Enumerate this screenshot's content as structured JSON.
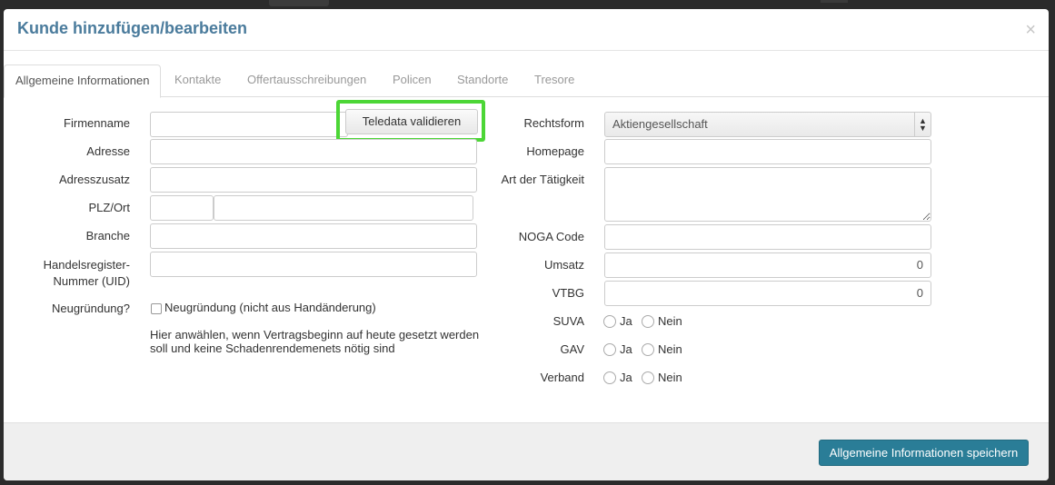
{
  "modal": {
    "title": "Kunde hinzufügen/bearbeiten",
    "close": "×"
  },
  "tabs": [
    {
      "label": "Allgemeine Informationen"
    },
    {
      "label": "Kontakte"
    },
    {
      "label": "Offertausschreibungen"
    },
    {
      "label": "Policen"
    },
    {
      "label": "Standorte"
    },
    {
      "label": "Tresore"
    }
  ],
  "left": {
    "firmenname": {
      "label": "Firmenname",
      "value": ""
    },
    "validate_button": "Teledata validieren",
    "adresse": {
      "label": "Adresse",
      "value": ""
    },
    "adresszusatz": {
      "label": "Adresszusatz",
      "value": ""
    },
    "plzort": {
      "label": "PLZ/Ort",
      "plz": "",
      "ort": ""
    },
    "branche": {
      "label": "Branche",
      "value": ""
    },
    "hr_label_1": "Handelsregister-",
    "hr_label_2": "Nummer (UID)",
    "neugruendung": {
      "label": "Neugründung?",
      "checkbox_label": "Neugründung (nicht aus Handänderung)",
      "help_1": "Hier anwählen, wenn Vertragsbeginn auf heute gesetzt werden",
      "help_2": "soll und keine Schadenrendemenets nötig sind"
    }
  },
  "right": {
    "rechtsform": {
      "label": "Rechtsform",
      "value": "Aktiengesellschaft"
    },
    "homepage": {
      "label": "Homepage",
      "value": ""
    },
    "taetigkeit": {
      "label": "Art der Tätigkeit",
      "value": ""
    },
    "noga": {
      "label": "NOGA Code",
      "value": ""
    },
    "umsatz": {
      "label": "Umsatz",
      "value": "0"
    },
    "vtbg": {
      "label": "VTBG",
      "value": "0"
    },
    "suva": {
      "label": "SUVA",
      "ja": "Ja",
      "nein": "Nein"
    },
    "gav": {
      "label": "GAV",
      "ja": "Ja",
      "nein": "Nein"
    },
    "verband": {
      "label": "Verband",
      "ja": "Ja",
      "nein": "Nein"
    }
  },
  "footer": {
    "save_button": "Allgemeine Informationen speichern"
  },
  "colors": {
    "title": "#4a7b9c",
    "highlight": "#4cd636",
    "primary_button": "#2a7d97"
  }
}
